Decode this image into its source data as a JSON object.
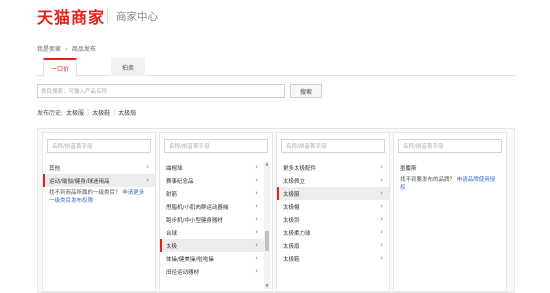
{
  "header": {
    "logo": "天猫商家",
    "subtitle": "商家中心"
  },
  "breadcrumb": {
    "home": "我是卖家",
    "chevron": "›",
    "current": "商品发布"
  },
  "tabs": [
    {
      "label": "一口价"
    },
    {
      "label": "拍卖"
    }
  ],
  "category_search": {
    "placeholder": "类目搜索：可输入产品名称",
    "button": "搜索"
  },
  "history": {
    "label": "发布历史:",
    "items": [
      "太极服",
      "太极鞋",
      "太极扇"
    ],
    "separator": "|"
  },
  "columns": [
    {
      "search_placeholder": "名称/拼音首字母",
      "items": [
        {
          "label": "其他",
          "has_children": true
        },
        {
          "label": "运动/瑜伽/健身/球迷用品",
          "has_children": true,
          "selected": true
        }
      ],
      "hint": "找不到商品所属的一级类目？",
      "hint_link": "申请更多一级类目发布权限"
    },
    {
      "search_placeholder": "名称/拼音首字母",
      "items": [
        {
          "label": "曲棍球",
          "has_children": true
        },
        {
          "label": "赛事纪念品",
          "has_children": true
        },
        {
          "label": "射箭",
          "has_children": true
        },
        {
          "label": "甩脂机/小肌肉群运动器械",
          "has_children": true
        },
        {
          "label": "跑步机/中小型健身器材",
          "has_children": true
        },
        {
          "label": "台球",
          "has_children": true
        },
        {
          "label": "太极",
          "has_children": true,
          "selected": true
        },
        {
          "label": "体操/健美操/啦啦操",
          "has_children": true
        },
        {
          "label": "田径运动器材",
          "has_children": true
        }
      ]
    },
    {
      "search_placeholder": "名称/拼音首字母",
      "items": [
        {
          "label": "更多太极配件",
          "has_children": true
        },
        {
          "label": "太极佩立",
          "has_children": true
        },
        {
          "label": "太极服",
          "has_children": true,
          "selected": true
        },
        {
          "label": "太极帽",
          "has_children": true
        },
        {
          "label": "太极剑",
          "has_children": true
        },
        {
          "label": "太极柔力球",
          "has_children": true
        },
        {
          "label": "太极扇",
          "has_children": true
        },
        {
          "label": "太极鞋",
          "has_children": true
        }
      ]
    },
    {
      "search_placeholder": "名称/拼音首字母",
      "items": [
        {
          "label": "墨麋斯",
          "has_children": false
        }
      ],
      "hint": "找不到要发布的品牌？",
      "hint_link": "申请品牌使用授权"
    }
  ],
  "icons": {
    "arrow": "chevron-right-icon",
    "scroll_up": "scroll-up-icon",
    "scroll_down": "scroll-down-icon"
  },
  "colors": {
    "brand": "#e2231a",
    "link": "#3a6fc4"
  }
}
